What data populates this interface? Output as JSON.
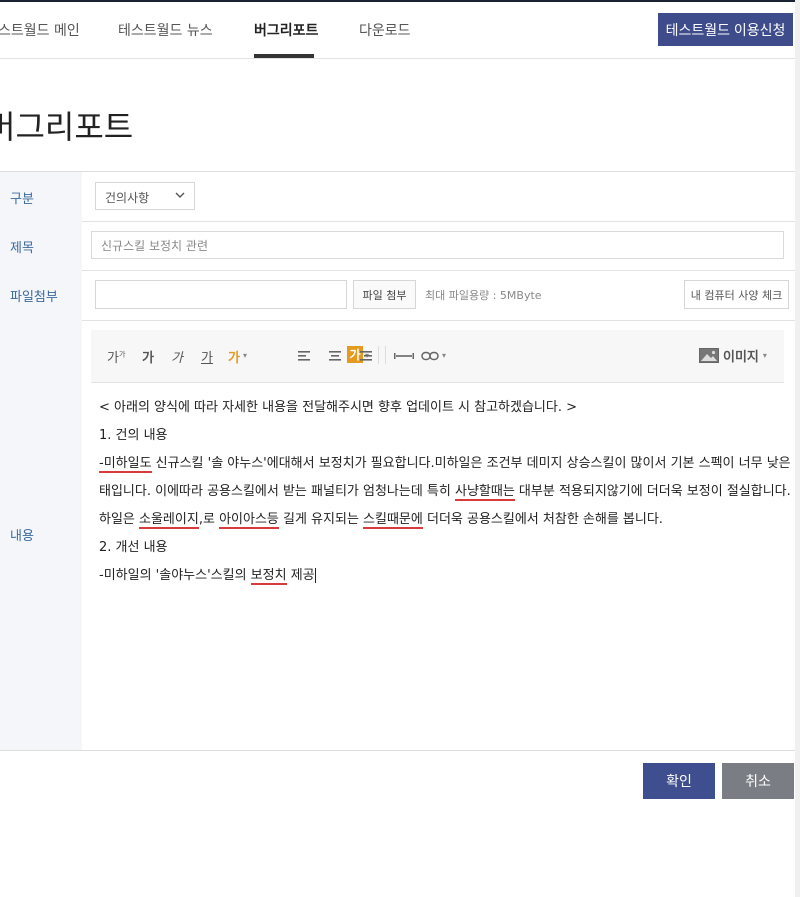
{
  "nav": {
    "items": [
      "스트월드 메인",
      "테스트월드 뉴스",
      "버그리포트",
      "다운로드"
    ],
    "active_index": 2,
    "apply_button": "테스트월드 이용신청"
  },
  "page_title": "버그리포트",
  "form": {
    "category": {
      "label": "구분",
      "selected": "건의사항"
    },
    "title": {
      "label": "제목",
      "value": "신규스킬 보정치 관련"
    },
    "attachment": {
      "label": "파일첨부",
      "value": "",
      "button": "파일 첨부",
      "note": "최대 파일용량 : 5MByte",
      "spec_button": "내 컴퓨터 사양 체크"
    },
    "content": {
      "label": "내용",
      "toolbar": {
        "font_size": "가",
        "font_size_sup": "가",
        "bold": "가",
        "italic": "가",
        "underline": "가",
        "text_color": "가",
        "bg_color": "가",
        "image": "이미지"
      },
      "lines": [
        [
          {
            "t": "< 아래의 양식에 따라 자세한 내용을 전달해주시면 향후 업데이트 시 참고하겠습니다. >"
          }
        ],
        [
          {
            "t": "1. 건의 내용"
          }
        ],
        [
          {
            "t": "-미하일도",
            "sq": true
          },
          {
            "t": " 신규스킬 '솔 야누스'에대해서 보정치가 필요합니다.미하일은 조건부 데미지 상승스킬이 많이서 기본 스펙이 너무 낮은 상대"
          }
        ],
        [
          {
            "t": "태입니다. 이에따라 공용스킬에서 받는 패널티가 엄청나는데 특히 "
          },
          {
            "t": "사냥할때는",
            "sq": true
          },
          {
            "t": " 대부분 적용되지않기에 더더욱 보정이 절실합니다. 미"
          }
        ],
        [
          {
            "t": "하일은 "
          },
          {
            "t": "소울레이지",
            "sq": true
          },
          {
            "t": ",로 "
          },
          {
            "t": "아이아스등",
            "sq": true
          },
          {
            "t": " 길게 유지되는 "
          },
          {
            "t": "스킬때문에",
            "sq": true
          },
          {
            "t": " 더더욱 공용스킬에서 처참한 손해를 봅니다."
          }
        ],
        [
          {
            "t": "2. 개선 내용"
          }
        ],
        [
          {
            "t": "-미하일의 '솔야누스'스킬의 "
          },
          {
            "t": "보정치",
            "sq": true
          },
          {
            "t": " 제공"
          }
        ]
      ]
    }
  },
  "buttons": {
    "confirm": "확인",
    "cancel": "취소"
  },
  "colors": {
    "primary": "#3e4c8c",
    "cancel": "#7a7d83",
    "label": "#3b6a9c",
    "label_bg": "#f4f6fa",
    "accent_orange": "#e59a1d",
    "spellcheck": "#d93b3b"
  },
  "icons": [
    "chevron-down-icon",
    "align-left-icon",
    "align-center-icon",
    "align-right-icon",
    "horizontal-line-icon",
    "link-icon",
    "image-icon"
  ]
}
